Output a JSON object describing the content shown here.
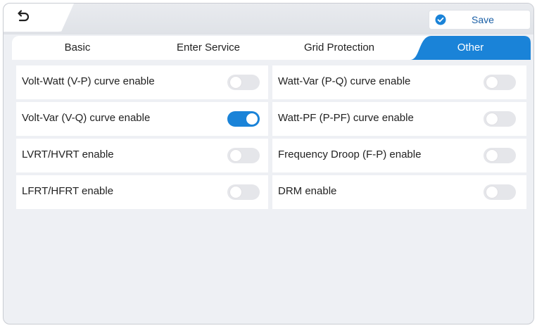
{
  "header": {
    "save_label": "Save"
  },
  "tabs": [
    {
      "label": "Basic",
      "active": false
    },
    {
      "label": "Enter Service",
      "active": false
    },
    {
      "label": "Grid Protection",
      "active": false
    },
    {
      "label": "Other",
      "active": true
    }
  ],
  "settings": {
    "left": [
      {
        "label": "Volt-Watt (V-P) curve enable",
        "enabled": false
      },
      {
        "label": "Volt-Var (V-Q) curve enable",
        "enabled": true
      },
      {
        "label": "LVRT/HVRT enable",
        "enabled": false
      },
      {
        "label": "LFRT/HFRT enable",
        "enabled": false
      }
    ],
    "right": [
      {
        "label": "Watt-Var (P-Q) curve enable",
        "enabled": false
      },
      {
        "label": "Watt-PF (P-PF) curve enable",
        "enabled": false
      },
      {
        "label": "Frequency Droop (F-P) enable",
        "enabled": false
      },
      {
        "label": "DRM enable",
        "enabled": false
      }
    ]
  },
  "colors": {
    "accent": "#1a83d8",
    "toggle_off": "#e5e6ea",
    "background": "#eef0f4"
  },
  "icons": {
    "back": "back-arrow-icon",
    "save": "check-circle-icon"
  }
}
